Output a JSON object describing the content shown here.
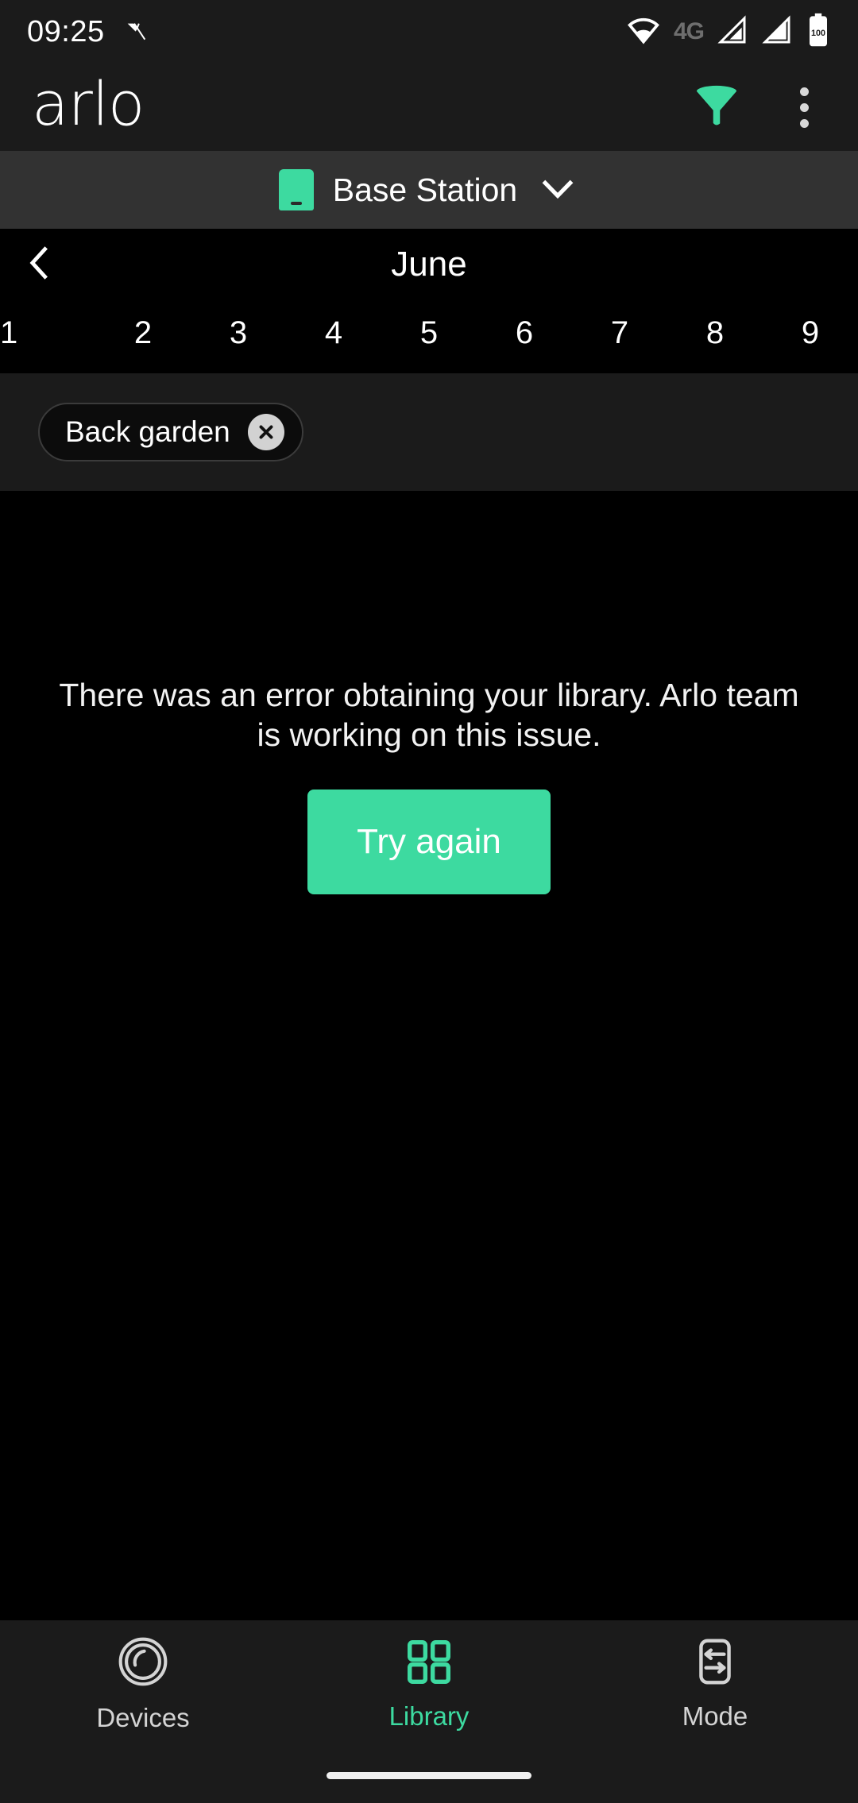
{
  "status_bar": {
    "clock": "09:25",
    "network_type": "4G",
    "battery_level": "100",
    "icons": [
      "vpn-key-icon",
      "wifi-icon",
      "signal-cellular-1-icon",
      "signal-cellular-2-icon",
      "battery-icon"
    ]
  },
  "app_bar": {
    "logo_text": "arlo",
    "filter_icon": "filter-funnel-icon",
    "overflow_icon": "overflow-menu-icon"
  },
  "base_station": {
    "label": "Base Station",
    "icon": "base-station-icon",
    "chevron": "chevron-down-icon"
  },
  "calendar": {
    "month": "June",
    "back_icon": "chevron-left-icon",
    "days": [
      "1",
      "2",
      "3",
      "4",
      "5",
      "6",
      "7",
      "8",
      "9"
    ]
  },
  "filters": {
    "chips": [
      {
        "label": "Back garden",
        "remove_icon": "close-circle-icon"
      }
    ]
  },
  "error": {
    "message": "There was an error obtaining your library. Arlo team is working on this issue.",
    "retry_label": "Try again"
  },
  "bottom_nav": {
    "items": [
      {
        "label": "Devices",
        "icon": "camera-lens-icon",
        "active": false
      },
      {
        "label": "Library",
        "icon": "grid-squares-icon",
        "active": true
      },
      {
        "label": "Mode",
        "icon": "mode-sliders-icon",
        "active": false
      }
    ]
  },
  "colors": {
    "accent_green": "#3ddaa0",
    "app_bar_bg": "#1b1b1b",
    "base_bar_bg": "#323232",
    "page_bg": "#000000"
  }
}
